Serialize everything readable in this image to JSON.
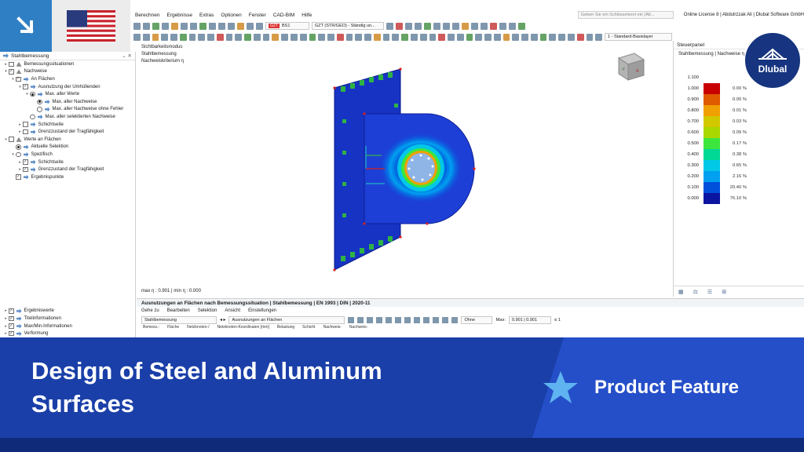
{
  "badge": {
    "arrow_icon": "arrow-down-right-icon",
    "flag_icon": "us-flag-icon"
  },
  "menubar": {
    "items": [
      "Berechnen",
      "Ergebnisse",
      "Extras",
      "Optionen",
      "Fenster",
      "CAD-BIM",
      "Hilfe"
    ],
    "search_placeholder": "Geben Sie ein Schlüsselwort ein (Alt...",
    "license": "Online License 8 | Abdulrzzak Ali | Dlubal Software GmbH"
  },
  "toolbar": {
    "load_tag": "GZT",
    "load_case": "BS1",
    "combination": "GZT (STR/GEO) - Ständig un...",
    "layer": "1 - Standard-Basislayer"
  },
  "navigator": {
    "title": "Stahlbemessung",
    "tree": [
      {
        "label": "Bemessungssituationen",
        "level": 0,
        "kind": "cb",
        "checked": false,
        "expander": ">"
      },
      {
        "label": "Nachweise",
        "level": 0,
        "kind": "cb",
        "checked": true,
        "expander": "v"
      },
      {
        "label": "An Flächen",
        "level": 1,
        "kind": "cb",
        "checked": true,
        "expander": "v"
      },
      {
        "label": "Ausnutzung der Umhüllenden",
        "level": 2,
        "kind": "cb",
        "checked": true,
        "expander": "v"
      },
      {
        "label": "Max. aller Werte",
        "level": 3,
        "kind": "rb",
        "checked": true,
        "expander": "v"
      },
      {
        "label": "Max. aller Nachweise",
        "level": 4,
        "kind": "rb",
        "checked": true,
        "expander": ""
      },
      {
        "label": "Max. aller Nachweise ohne Fehler",
        "level": 4,
        "kind": "rb",
        "checked": false,
        "expander": ""
      },
      {
        "label": "Max. aller selektierten Nachweise",
        "level": 3,
        "kind": "rb",
        "checked": false,
        "expander": ""
      },
      {
        "label": "Schichtseite",
        "level": 2,
        "kind": "cb",
        "checked": false,
        "expander": ">"
      },
      {
        "label": "Grenzzustand der Tragfähigkeit",
        "level": 2,
        "kind": "cb",
        "checked": false,
        "expander": ">"
      },
      {
        "label": "Werte an Flächen",
        "level": 0,
        "kind": "cb",
        "checked": false,
        "expander": "v"
      },
      {
        "label": "Aktuelle Selektion",
        "level": 1,
        "kind": "rb",
        "checked": true,
        "expander": ""
      },
      {
        "label": "Spezifisch",
        "level": 1,
        "kind": "rb",
        "checked": false,
        "expander": "v"
      },
      {
        "label": "Schichtseite",
        "level": 2,
        "kind": "cb",
        "checked": true,
        "expander": ">"
      },
      {
        "label": "Grenzzustand der Tragfähigkeit",
        "level": 2,
        "kind": "cb",
        "checked": true,
        "expander": ">"
      },
      {
        "label": "Ergebnispunkte",
        "level": 1,
        "kind": "cb",
        "checked": true,
        "expander": ""
      }
    ],
    "bottom": [
      "Ergebniswerte",
      "Titelinformationen",
      "Max/Min-Informationen",
      "Verformung"
    ]
  },
  "viewport": {
    "info_lines": [
      "Sichtbarkeitsmodus",
      "Stahlbemessung",
      "Nachweiskriterium η"
    ],
    "footer": "max η : 0.901 | min η : 0.000",
    "cube_faces": [
      "-Y",
      "X"
    ]
  },
  "panel": {
    "title": "Steuerpanel",
    "subtitle": "Stahlbemessung | Nachweise η",
    "legend": [
      {
        "value": "1.100",
        "color": "",
        "pct": ""
      },
      {
        "value": "1.000",
        "color": "#c80000",
        "pct": "0.00 %"
      },
      {
        "value": "0.900",
        "color": "#e05a00",
        "pct": "0.00 %"
      },
      {
        "value": "0.800",
        "color": "#f0a000",
        "pct": "0.01 %"
      },
      {
        "value": "0.700",
        "color": "#d2c800",
        "pct": "0.03 %"
      },
      {
        "value": "0.600",
        "color": "#a8d800",
        "pct": "0.09 %"
      },
      {
        "value": "0.500",
        "color": "#3ce63c",
        "pct": "0.17 %"
      },
      {
        "value": "0.400",
        "color": "#00d896",
        "pct": "0.38 %"
      },
      {
        "value": "0.300",
        "color": "#00c8e6",
        "pct": "0.65 %"
      },
      {
        "value": "0.200",
        "color": "#00a0f0",
        "pct": "2.16 %"
      },
      {
        "value": "0.100",
        "color": "#0050dc",
        "pct": "20.40 %"
      },
      {
        "value": "0.000",
        "color": "#0a14a0",
        "pct": "76.10 %"
      }
    ]
  },
  "table": {
    "title": "Ausnutzungen an Flächen nach Bemessungssituation | Stahlbemessung | EN 1993 | DIN | 2020-11",
    "menu": [
      "Gehe zu",
      "Bearbeiten",
      "Selektion",
      "Ansicht",
      "Einstellungen"
    ],
    "type_combo": "Stahlbemessung",
    "result_combo": "Ausnutzungen an Flächen",
    "filter": "Ohne",
    "max_label": "Max:",
    "max_value": "0.901 | 0.901",
    "limit": "≤ 1",
    "columns": [
      "Bemess.-",
      "Fläche",
      "Netzknoten-/",
      "Netzknoten-Koordinaten [mm]",
      "Belastung",
      "Schicht",
      "Nachweis-",
      "Nachweis-"
    ]
  },
  "banner": {
    "title_line1": "Design of Steel and Aluminum",
    "title_line2": "Surfaces",
    "feature": "Product Feature",
    "star_icon": "star-icon"
  },
  "logo": {
    "text": "Dlubal",
    "icon": "dlubal-bridge-icon"
  }
}
